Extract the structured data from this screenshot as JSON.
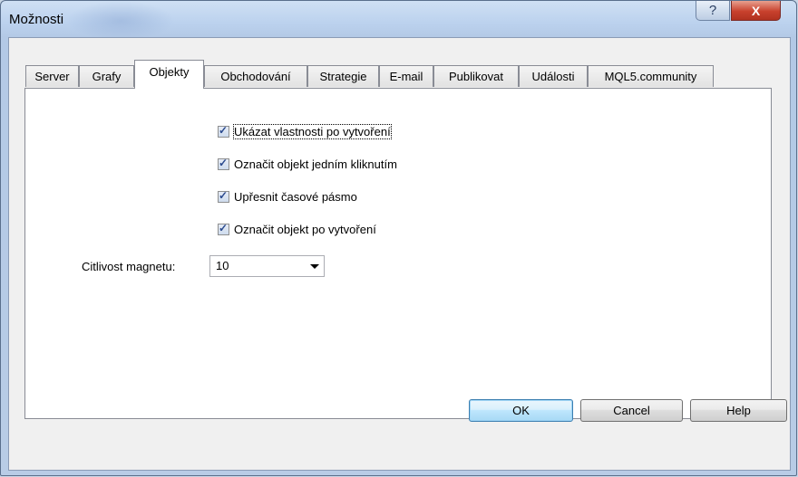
{
  "window": {
    "title": "Možnosti",
    "help_symbol": "?",
    "close_symbol": "X"
  },
  "tabs": [
    {
      "label": "Server"
    },
    {
      "label": "Grafy"
    },
    {
      "label": "Objekty",
      "active": true
    },
    {
      "label": "Obchodování"
    },
    {
      "label": "Strategie"
    },
    {
      "label": "E-mail"
    },
    {
      "label": "Publikovat"
    },
    {
      "label": "Události"
    },
    {
      "label": "MQL5.community"
    }
  ],
  "options": [
    {
      "label": "Ukázat vlastnosti po vytvoření",
      "checked": true
    },
    {
      "label": "Označit objekt jedním kliknutím",
      "checked": true
    },
    {
      "label": "Upřesnit časové pásmo",
      "checked": true
    },
    {
      "label": "Označit objekt po vytvoření",
      "checked": true
    }
  ],
  "magnet": {
    "label": "Citlivost magnetu:",
    "value": "10"
  },
  "buttons": {
    "ok": "OK",
    "cancel": "Cancel",
    "help": "Help"
  },
  "colors": {
    "title_bar": "#bcd2ee",
    "close_button": "#c8412d",
    "panel": "#ffffff"
  }
}
